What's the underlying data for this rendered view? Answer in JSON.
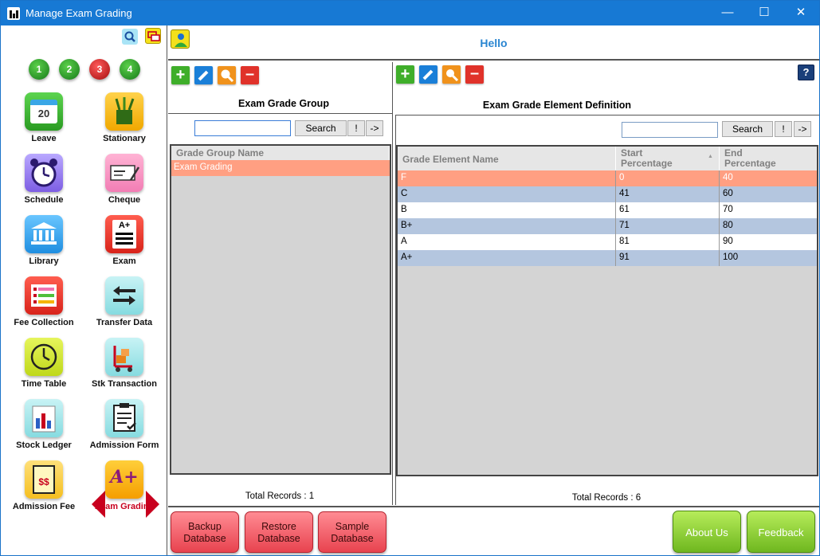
{
  "window": {
    "title": "Manage Exam Grading",
    "minimize": "—",
    "maximize": "☐",
    "close": "✕"
  },
  "sidebar": {
    "steps": [
      "1",
      "2",
      "3",
      "4"
    ],
    "tiles": [
      {
        "label": "Leave",
        "icon": "calendar-icon"
      },
      {
        "label": "Stationary",
        "icon": "stationary-icon"
      },
      {
        "label": "Schedule",
        "icon": "alarm-clock-icon"
      },
      {
        "label": "Cheque",
        "icon": "cheque-icon"
      },
      {
        "label": "Library",
        "icon": "library-icon"
      },
      {
        "label": "Exam",
        "icon": "exam-icon"
      },
      {
        "label": "Fee Collection",
        "icon": "fee-collection-icon"
      },
      {
        "label": "Transfer Data",
        "icon": "transfer-data-icon"
      },
      {
        "label": "Time Table",
        "icon": "clock-icon"
      },
      {
        "label": "Stk Transaction",
        "icon": "stock-transaction-icon"
      },
      {
        "label": "Stock Ledger",
        "icon": "stock-ledger-icon"
      },
      {
        "label": "Admission Form",
        "icon": "admission-form-icon"
      },
      {
        "label": "Admission Fee",
        "icon": "admission-fee-icon"
      },
      {
        "label": "Exam Grading",
        "icon": "exam-grading-icon"
      }
    ],
    "exam_icon_text": "A+",
    "fee_icon_text": "$$",
    "grading_icon_text": "A+",
    "calendar_day": "20"
  },
  "header": {
    "greeting": "Hello"
  },
  "group_panel": {
    "title": "Exam Grade Group",
    "search_value": "",
    "search_label": "Search",
    "bang_label": "!",
    "next_label": "->",
    "columns": [
      "Grade Group Name"
    ],
    "rows": [
      "Exam Grading"
    ],
    "total": "Total Records : 1"
  },
  "element_panel": {
    "title": "Exam Grade Element Definition",
    "help_label": "?",
    "search_value": "",
    "search_label": "Search",
    "bang_label": "!",
    "next_label": "->",
    "columns": [
      "Grade Element Name",
      "Start\nPercentage",
      "End\nPercentage"
    ],
    "sort_arrow": "▲",
    "rows": [
      {
        "name": "F",
        "start": "0",
        "end": "40"
      },
      {
        "name": "C",
        "start": "41",
        "end": "60"
      },
      {
        "name": "B",
        "start": "61",
        "end": "70"
      },
      {
        "name": "B+",
        "start": "71",
        "end": "80"
      },
      {
        "name": "A",
        "start": "81",
        "end": "90"
      },
      {
        "name": "A+",
        "start": "91",
        "end": "100"
      }
    ],
    "total": "Total Records : 6"
  },
  "bottom": {
    "backup": "Backup\nDatabase",
    "restore": "Restore\nDatabase",
    "sample": "Sample\nDatabase",
    "about": "About Us",
    "feedback": "Feedback"
  },
  "colors": {
    "titlebar": "#1779d4",
    "selected_row": "#ff9f82",
    "alt_row": "#b4c6df",
    "accent_red": "#c8001e",
    "hello": "#2a86d1"
  }
}
